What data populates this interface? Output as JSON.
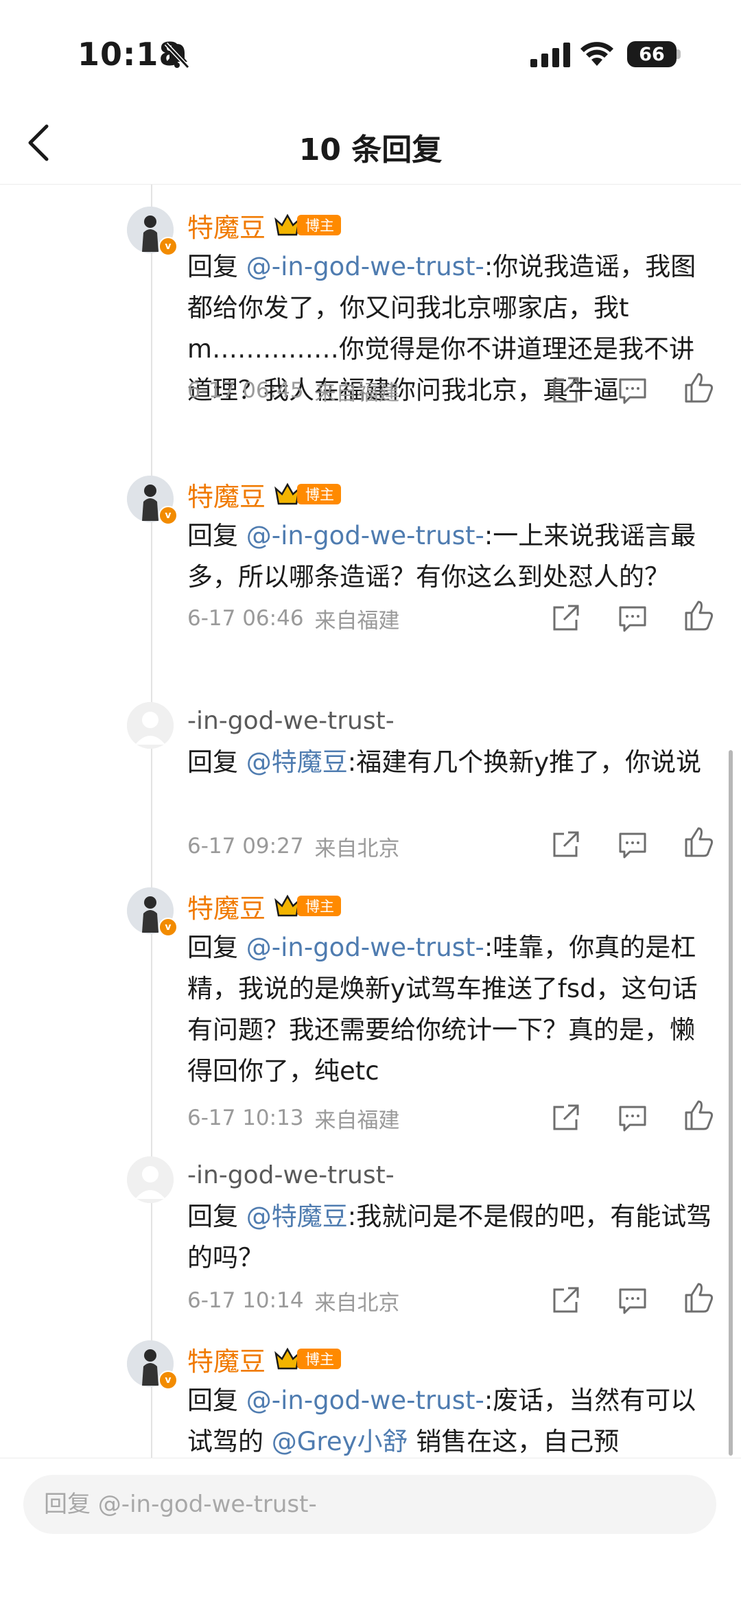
{
  "status_bar": {
    "time": "10:18",
    "battery_level": "66",
    "icons": [
      "bell-muted-icon",
      "cellular-signal-icon",
      "wifi-icon",
      "battery-icon"
    ]
  },
  "nav": {
    "title": "10 条回复",
    "back_icon": "chevron-left-icon"
  },
  "comments": [
    {
      "username": "特魔豆",
      "badge": "博主",
      "reply_prefix": "回复 ",
      "mention": "@-in-god-we-trust-",
      "body": ":你说我造谣，我图都给你发了，你又问我北京哪家店，我tm……………你觉得是你不讲道理还是我不讲道理？我人在福建你问我北京，真牛逼",
      "date": "6-17 06:45",
      "location": "来自福建"
    },
    {
      "username": "特魔豆",
      "badge": "博主",
      "reply_prefix": "回复 ",
      "mention": "@-in-god-we-trust-",
      "body": ":一上来说我谣言最多，所以哪条造谣？有你这么到处怼人的？",
      "date": "6-17 06:46",
      "location": "来自福建"
    },
    {
      "username": "-in-god-we-trust-",
      "reply_prefix": "回复 ",
      "mention": "@特魔豆",
      "body": ":福建有几个换新y推了，你说说",
      "date": "6-17 09:27",
      "location": "来自北京"
    },
    {
      "username": "特魔豆",
      "badge": "博主",
      "reply_prefix": "回复 ",
      "mention": "@-in-god-we-trust-",
      "body": ":哇靠，你真的是杠精，我说的是焕新y试驾车推送了fsd，这句话有问题？我还需要给你统计一下？真的是，懒得回你了，纯etc",
      "date": "6-17 10:13",
      "location": "来自福建"
    },
    {
      "username": "-in-god-we-trust-",
      "reply_prefix": "回复 ",
      "mention": "@特魔豆",
      "body": ":我就问是不是假的吧，有能试驾的吗？",
      "date": "6-17 10:14",
      "location": "来自北京"
    },
    {
      "username": "特魔豆",
      "badge": "博主",
      "reply_prefix": "回复 ",
      "mention": "@-in-god-we-trust-",
      "body_before": ":废话，当然有可以试驾的 ",
      "mention2": "@Grey小舒",
      "body_after": " 销售在这，自己预"
    }
  ],
  "reply_box": {
    "placeholder": "回复 @-in-god-we-trust-"
  },
  "colors": {
    "username_verified": "#f07a00",
    "mention": "#4f7cb0",
    "badge_bg": "#ff8a00",
    "meta_text": "#9a9a9a"
  }
}
